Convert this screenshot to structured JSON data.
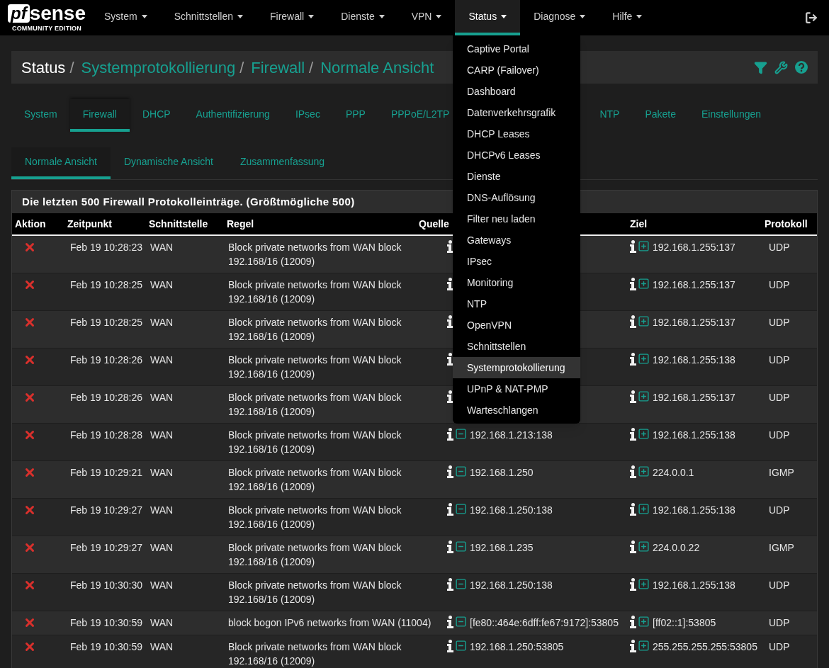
{
  "logo": {
    "mark": "pf",
    "name": "sense",
    "edition": "COMMUNITY EDITION"
  },
  "nav": [
    {
      "label": "System",
      "selected": false
    },
    {
      "label": "Schnittstellen",
      "selected": false
    },
    {
      "label": "Firewall",
      "selected": false
    },
    {
      "label": "Dienste",
      "selected": false
    },
    {
      "label": "VPN",
      "selected": false
    },
    {
      "label": "Status",
      "selected": true
    },
    {
      "label": "Diagnose",
      "selected": false
    },
    {
      "label": "Hilfe",
      "selected": false
    }
  ],
  "status_menu": [
    {
      "label": "Captive Portal",
      "selected": false
    },
    {
      "label": "CARP (Failover)",
      "selected": false
    },
    {
      "label": "Dashboard",
      "selected": false
    },
    {
      "label": "Datenverkehrsgrafik",
      "selected": false
    },
    {
      "label": "DHCP Leases",
      "selected": false
    },
    {
      "label": "DHCPv6 Leases",
      "selected": false
    },
    {
      "label": "Dienste",
      "selected": false
    },
    {
      "label": "DNS-Auflösung",
      "selected": false
    },
    {
      "label": "Filter neu laden",
      "selected": false
    },
    {
      "label": "Gateways",
      "selected": false
    },
    {
      "label": "IPsec",
      "selected": false
    },
    {
      "label": "Monitoring",
      "selected": false
    },
    {
      "label": "NTP",
      "selected": false
    },
    {
      "label": "OpenVPN",
      "selected": false
    },
    {
      "label": "Schnittstellen",
      "selected": false
    },
    {
      "label": "Systemprotokollierung",
      "selected": true
    },
    {
      "label": "UPnP & NAT-PMP",
      "selected": false
    },
    {
      "label": "Warteschlangen",
      "selected": false
    }
  ],
  "breadcrumb": [
    "Status",
    "Systemprotokollierung",
    "Firewall",
    "Normale Ansicht"
  ],
  "breadcrumb_separator": "/",
  "tabs": [
    {
      "label": "System",
      "selected": false
    },
    {
      "label": "Firewall",
      "selected": true
    },
    {
      "label": "DHCP",
      "selected": false
    },
    {
      "label": "Authentifizierung",
      "selected": false
    },
    {
      "label": "IPsec",
      "selected": false
    },
    {
      "label": "PPP",
      "selected": false
    },
    {
      "label": "PPPoE/L2TP",
      "selected": false
    },
    {
      "label": "NTP",
      "selected": false
    },
    {
      "label": "Pakete",
      "selected": false
    },
    {
      "label": "Einstellungen",
      "selected": false
    }
  ],
  "subtabs": [
    {
      "label": "Normale Ansicht",
      "selected": true
    },
    {
      "label": "Dynamische Ansicht",
      "selected": false
    },
    {
      "label": "Zusammenfassung",
      "selected": false
    }
  ],
  "table": {
    "title": "Die letzten 500 Firewall Protokolleinträge. (Größtmögliche 500)",
    "columns": [
      "Aktion",
      "Zeitpunkt",
      "Schnittstelle",
      "Regel",
      "Quelle",
      "Ziel",
      "Protokoll"
    ],
    "rows": [
      {
        "kind": "block",
        "time": "Feb 19 10:28:23",
        "interface": "WAN",
        "rule": "Block private networks from WAN block 192.168/16 (12009)",
        "destination": "192.168.1.255:137",
        "protocol": "UDP"
      },
      {
        "kind": "block",
        "time": "Feb 19 10:28:25",
        "interface": "WAN",
        "rule": "Block private networks from WAN block 192.168/16 (12009)",
        "destination": "192.168.1.255:137",
        "protocol": "UDP"
      },
      {
        "kind": "block",
        "time": "Feb 19 10:28:25",
        "interface": "WAN",
        "rule": "Block private networks from WAN block 192.168/16 (12009)",
        "destination": "192.168.1.255:137",
        "protocol": "UDP"
      },
      {
        "kind": "block",
        "time": "Feb 19 10:28:26",
        "interface": "WAN",
        "rule": "Block private networks from WAN block 192.168/16 (12009)",
        "destination": "192.168.1.255:138",
        "protocol": "UDP"
      },
      {
        "kind": "block",
        "time": "Feb 19 10:28:26",
        "interface": "WAN",
        "rule": "Block private networks from WAN block 192.168/16 (12009)",
        "destination": "192.168.1.255:137",
        "protocol": "UDP"
      },
      {
        "kind": "block",
        "time": "Feb 19 10:28:28",
        "interface": "WAN",
        "rule": "Block private networks from WAN block 192.168/16 (12009)",
        "source": "192.168.1.213:138",
        "destination": "192.168.1.255:138",
        "protocol": "UDP"
      },
      {
        "kind": "block",
        "time": "Feb 19 10:29:21",
        "interface": "WAN",
        "rule": "Block private networks from WAN block 192.168/16 (12009)",
        "source": "192.168.1.250",
        "destination": "224.0.0.1",
        "protocol": "IGMP"
      },
      {
        "kind": "block",
        "time": "Feb 19 10:29:27",
        "interface": "WAN",
        "rule": "Block private networks from WAN block 192.168/16 (12009)",
        "source": "192.168.1.250:138",
        "destination": "192.168.1.255:138",
        "protocol": "UDP"
      },
      {
        "kind": "block",
        "time": "Feb 19 10:29:27",
        "interface": "WAN",
        "rule": "Block private networks from WAN block 192.168/16 (12009)",
        "source": "192.168.1.235",
        "destination": "224.0.0.22",
        "protocol": "IGMP"
      },
      {
        "kind": "block",
        "time": "Feb 19 10:30:30",
        "interface": "WAN",
        "rule": "Block private networks from WAN block 192.168/16 (12009)",
        "source": "192.168.1.250:138",
        "destination": "192.168.1.255:138",
        "protocol": "UDP"
      },
      {
        "kind": "block",
        "time": "Feb 19 10:30:59",
        "interface": "WAN",
        "rule": "block bogon IPv6 networks from WAN (11004)",
        "source": "[fe80::464e:6dff:fe67:9172]:53805",
        "destination": "[ff02::1]:53805",
        "protocol": "UDP"
      },
      {
        "kind": "block",
        "time": "Feb 19 10:30:59",
        "interface": "WAN",
        "rule": "Block private networks from WAN block 192.168/16 (12009)",
        "source": "192.168.1.250:53805",
        "destination": "255.255.255.255:53805",
        "protocol": "UDP"
      }
    ]
  }
}
